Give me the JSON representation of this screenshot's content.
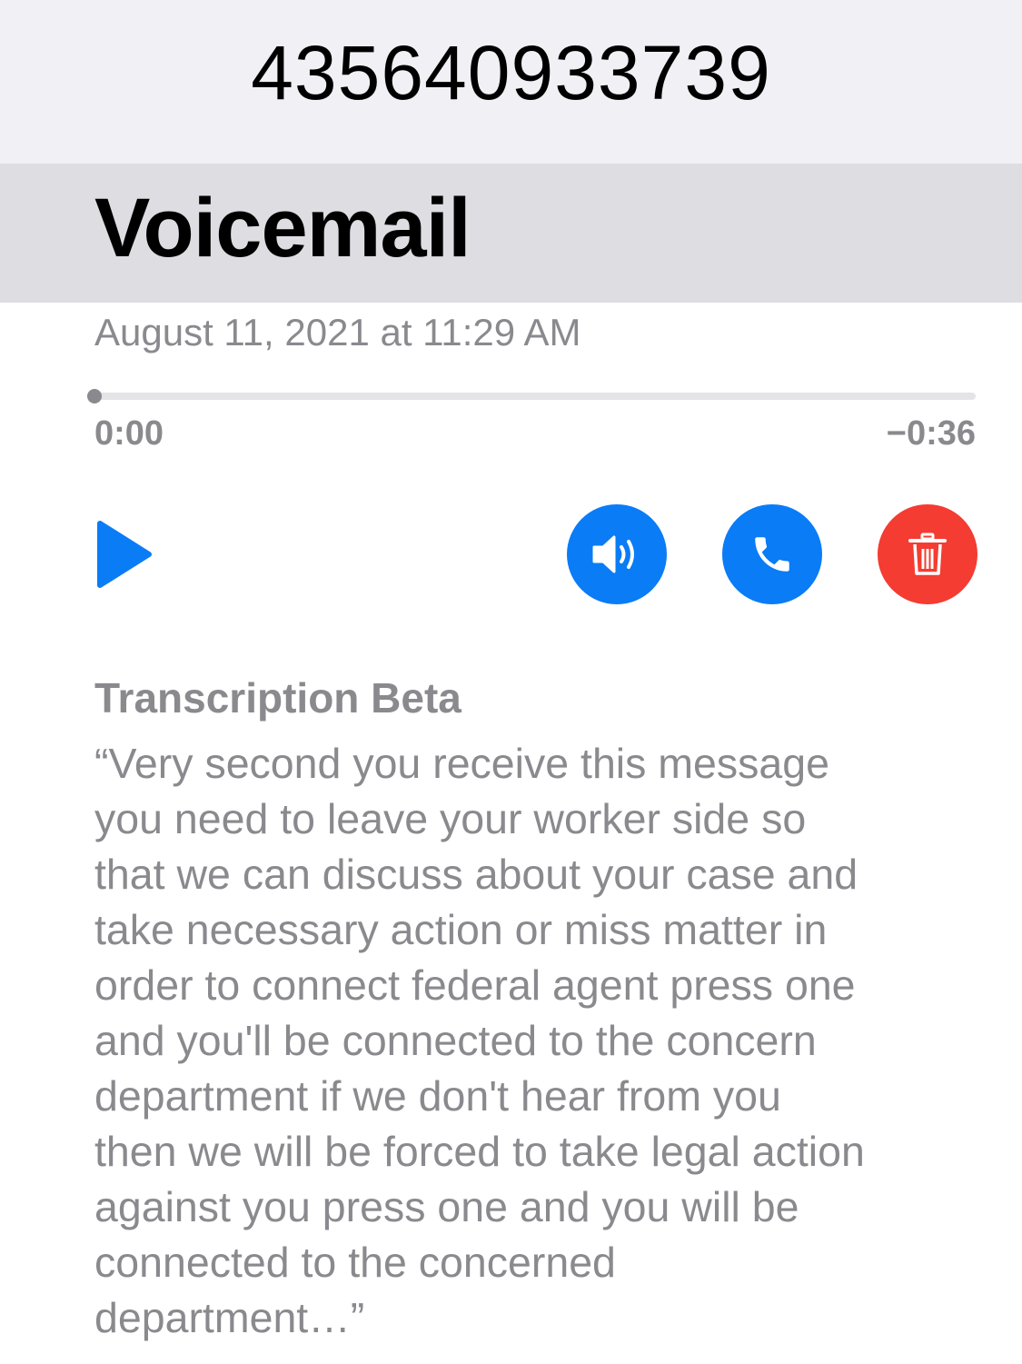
{
  "header": {
    "caller_number": "435640933739"
  },
  "title_bar": {
    "title": "Voicemail"
  },
  "voicemail": {
    "date": "August 11, 2021 at 11:29 AM",
    "progress_fraction": 0,
    "time_elapsed": "0:00",
    "time_remaining": "−0:36"
  },
  "controls": {
    "play_icon": "play-icon",
    "speaker_icon": "speaker-icon",
    "call_icon": "phone-icon",
    "delete_icon": "trash-icon"
  },
  "colors": {
    "accent_blue": "#0a7cf6",
    "delete_red": "#f43c32",
    "secondary_text": "#8a8a8e"
  },
  "transcription": {
    "label": "Transcription Beta",
    "text": "“Very second you receive this message\n you need to leave your worker side so\n that we can discuss about your case and\n take necessary action or miss matter in\n order to connect federal agent press one\n and you'll be connected to the concern\n department if we don't hear from you\n then we will be forced to take legal action\n against you press one and you will be\n connected to the concerned\n department…”"
  }
}
